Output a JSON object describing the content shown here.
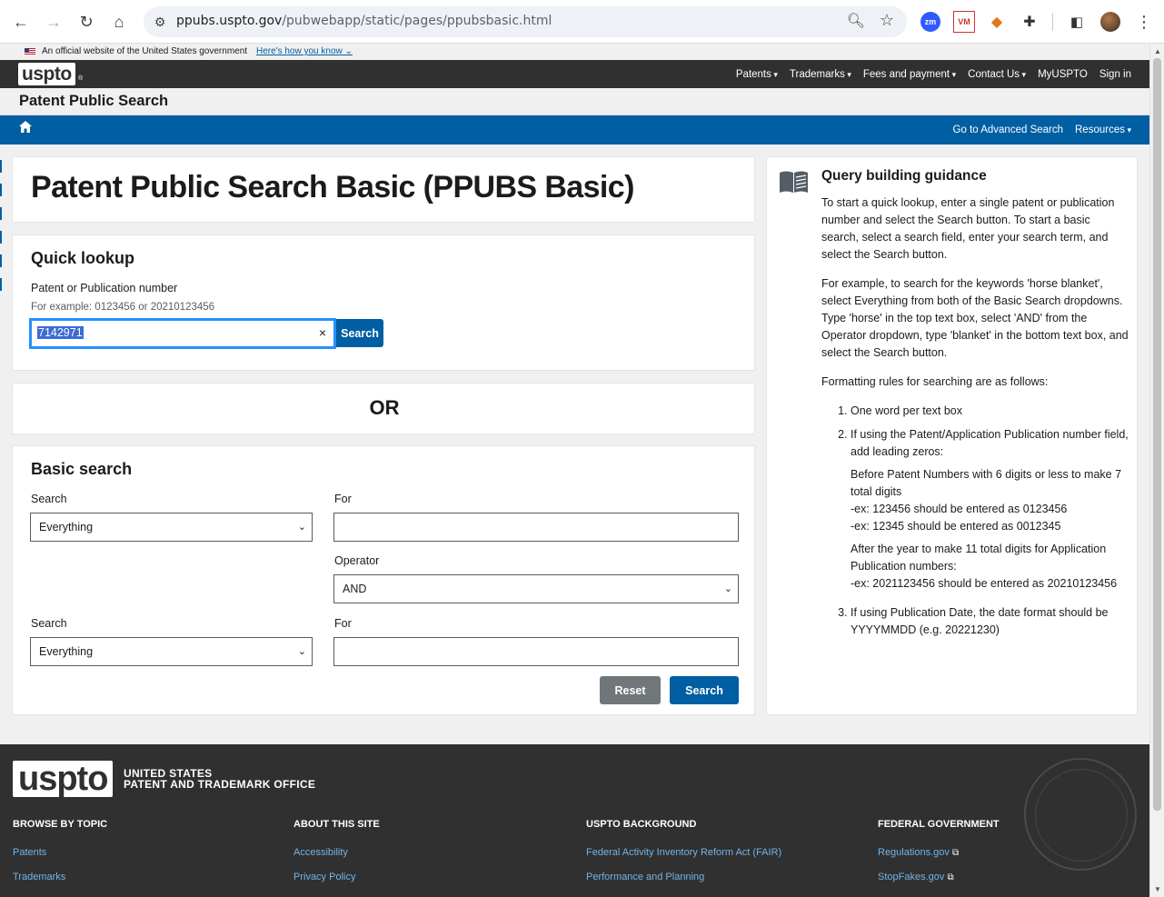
{
  "browser": {
    "url_host": "ppubs.uspto.gov",
    "url_path": "/pubwebapp/static/pages/ppubsbasic.html",
    "extensions": [
      "zm",
      "VM"
    ]
  },
  "gov_banner": {
    "text": "An official website of the United States government",
    "link": "Here's how you know"
  },
  "header": {
    "logo": "uspto",
    "logo_reg": "®",
    "nav": [
      "Patents",
      "Trademarks",
      "Fees and payment",
      "Contact Us",
      "MyUSPTO",
      "Sign in"
    ]
  },
  "subheader": {
    "title": "Patent Public Search"
  },
  "bluebar": {
    "advanced": "Go to Advanced Search",
    "resources": "Resources"
  },
  "page_title": "Patent Public Search Basic (PPUBS Basic)",
  "quick_lookup": {
    "title": "Quick lookup",
    "label": "Patent or Publication number",
    "hint": "For example: 0123456 or 20210123456",
    "value": "7142971",
    "clear": "×",
    "button": "Search"
  },
  "or_text": "OR",
  "basic_search": {
    "title": "Basic search",
    "search_label": "Search",
    "for_label": "For",
    "search1_value": "Everything",
    "operator_label": "Operator",
    "operator_value": "AND",
    "search2_value": "Everything",
    "reset": "Reset",
    "submit": "Search"
  },
  "guidance": {
    "title": "Query building guidance",
    "p1": "To start a quick lookup, enter a single patent or publication number and select the Search button. To start a basic search, select a search field, enter your search term, and select the Search button.",
    "p2": "For example, to search for the keywords 'horse blanket', select Everything from both of the Basic Search dropdowns. Type 'horse' in the top text box, select 'AND' from the Operator dropdown, type 'blanket' in the bottom text box, and select the Search button.",
    "p3": "Formatting rules for searching are as follows:",
    "rule1": "One word per text box",
    "rule2": "If using the Patent/Application Publication number field, add leading zeros:",
    "rule2_a_title": "Before Patent Numbers with 6 digits or less to make 7 total digits",
    "rule2_a_ex1": "-ex: 123456 should be entered as 0123456",
    "rule2_a_ex2": "-ex: 12345 should be entered as 0012345",
    "rule2_b_title": "After the year to make 11 total digits for Application Publication numbers:",
    "rule2_b_ex1": "-ex: 2021123456 should be entered as 20210123456",
    "rule3": "If using Publication Date, the date format should be YYYYMMDD (e.g. 20221230)"
  },
  "footer": {
    "logo": "uspto",
    "org_line1": "UNITED STATES",
    "org_line2": "PATENT AND TRADEMARK OFFICE",
    "columns": [
      {
        "heading": "BROWSE BY TOPIC",
        "links": [
          "Patents",
          "Trademarks"
        ]
      },
      {
        "heading": "ABOUT THIS SITE",
        "links": [
          "Accessibility",
          "Privacy Policy"
        ]
      },
      {
        "heading": "USPTO BACKGROUND",
        "links": [
          "Federal Activity Inventory Reform Act (FAIR)",
          "Performance and Planning"
        ]
      },
      {
        "heading": "FEDERAL GOVERNMENT",
        "links": [
          "Regulations.gov",
          "StopFakes.gov"
        ]
      }
    ]
  },
  "colors": {
    "primary": "#005ea2",
    "header": "#303030",
    "focus": "#2491ff",
    "reset": "#71767a",
    "footer_link": "#73b3e7"
  }
}
